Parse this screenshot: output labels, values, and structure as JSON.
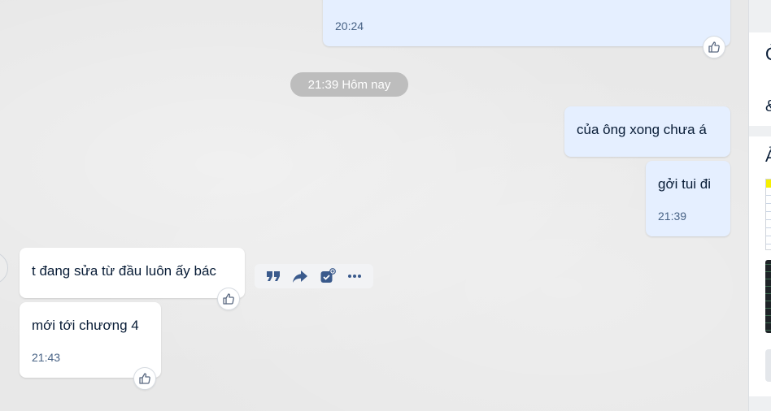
{
  "messages": {
    "top_sent": {
      "time": "20:24"
    },
    "date_divider": "21:39 Hôm nay",
    "sent_1": {
      "text": "của ông xong chưa á"
    },
    "sent_2": {
      "text": "gởi tui đi",
      "time": "21:39"
    },
    "recv_1": {
      "text": "t đang sửa từ đầu luôn ấy bác"
    },
    "recv_2": {
      "text": "mới tới chương 4",
      "time": "21:43"
    }
  },
  "hover_toolbar": {
    "actions": [
      "quote-icon",
      "forward-icon",
      "create-task-icon",
      "more-icon"
    ]
  },
  "right_panel": {
    "glyph_1": "Ở",
    "glyph_2": "&",
    "glyph_3": "Ả"
  },
  "colors": {
    "sent_bubble": "#e5efff",
    "received_bubble": "#ffffff",
    "chat_background": "#e8e8e8",
    "time_text": "#476285",
    "date_pill": "#bdbdbd"
  }
}
